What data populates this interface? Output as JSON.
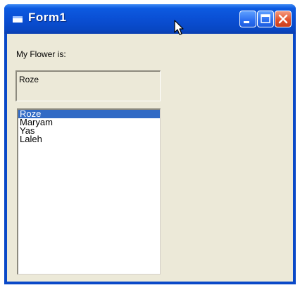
{
  "window": {
    "title": "Form1",
    "buttons": [
      "minimize",
      "maximize",
      "close"
    ]
  },
  "form": {
    "label": "My Flower is:",
    "textbox_value": "Roze",
    "list": {
      "items": [
        "Roze",
        "Maryam",
        "Yas",
        "Laleh"
      ],
      "selected_index": 0
    }
  },
  "colors": {
    "titlebar": "#0a4fd4",
    "client": "#ece9d8",
    "selection": "#316ac5",
    "close_button": "#e2512a"
  },
  "icons": [
    "app-icon",
    "minimize-icon",
    "maximize-icon",
    "close-icon",
    "mouse-pointer-icon"
  ]
}
